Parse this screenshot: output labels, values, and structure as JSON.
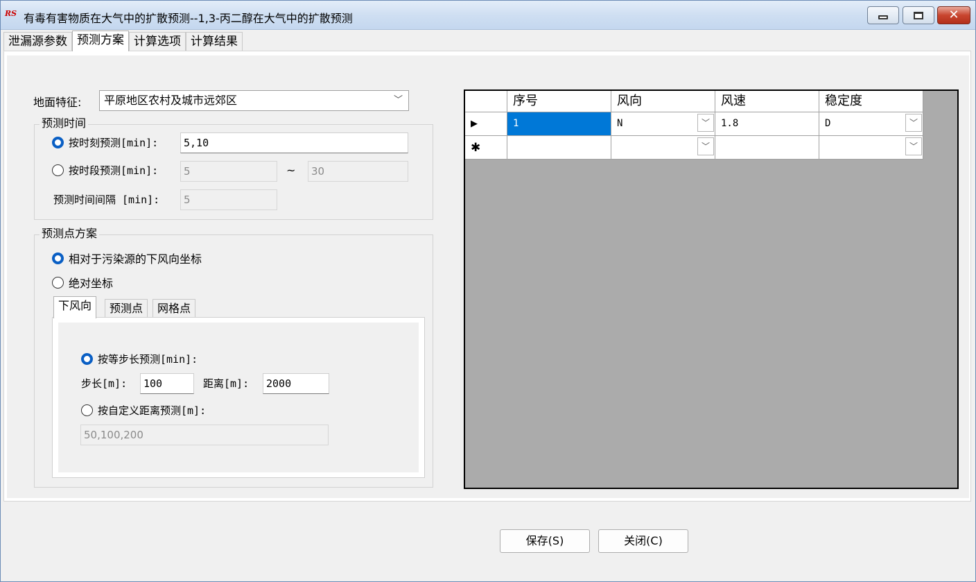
{
  "window": {
    "logo_text": "RS",
    "title": "有毒有害物质在大气中的扩散预测--1,3-丙二醇在大气中的扩散预测"
  },
  "tabs": [
    {
      "label": "泄漏源参数"
    },
    {
      "label": "预测方案"
    },
    {
      "label": "计算选项"
    },
    {
      "label": "计算结果"
    }
  ],
  "form": {
    "ground_label": "地面特征:",
    "ground_value": "平原地区农村及城市远郊区",
    "time_group_title": "预测时间",
    "by_moment_label": "按时刻预测[min]:",
    "by_moment_value": "5,10",
    "by_period_label": "按时段预测[min]:",
    "period_start": "5",
    "period_sep": "~",
    "period_end": "30",
    "interval_label": "预测时间间隔 [min]:",
    "interval_value": "5",
    "point_group_title": "预测点方案",
    "relative_label": "相对于污染源的下风向坐标",
    "absolute_label": "绝对坐标",
    "inner_tabs": [
      {
        "label": "下风向"
      },
      {
        "label": "预测点"
      },
      {
        "label": "网格点"
      }
    ],
    "equal_step_label": "按等步长预测[min]:",
    "step_label": "步长[m]:",
    "step_value": "100",
    "distance_label": "距离[m]:",
    "distance_value": "2000",
    "custom_label": "按自定义距离预测[m]:",
    "custom_value": "50,100,200"
  },
  "grid": {
    "columns": [
      "序号",
      "风向",
      "风速",
      "稳定度"
    ],
    "rows": [
      {
        "indicator": "▶",
        "seq": "1",
        "direction": "N",
        "speed": "1.8",
        "stability": "D"
      },
      {
        "indicator": "✱",
        "seq": "",
        "direction": "",
        "speed": "",
        "stability": ""
      }
    ]
  },
  "buttons": {
    "save": "保存(S)",
    "close": "关闭(C)"
  }
}
